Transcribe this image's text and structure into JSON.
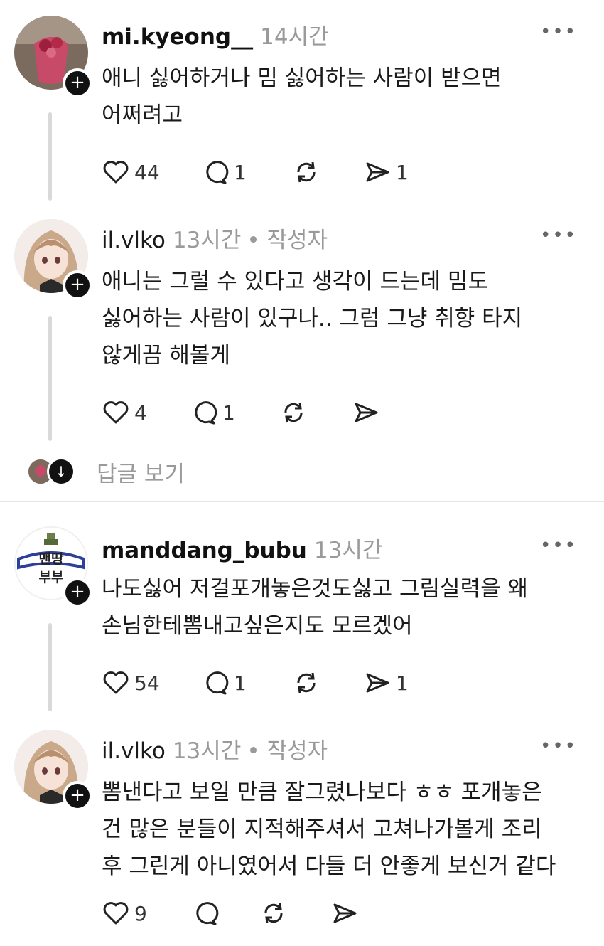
{
  "posts": [
    {
      "username": "mi.kyeong__",
      "time": "14시간",
      "author_tag": "",
      "lines": [
        "애니 싫어하거나 밈 싫어하는 사람이 받으면",
        "어쩌려고"
      ],
      "likes": "44",
      "replies": "1",
      "reposts": "",
      "shares": "1"
    },
    {
      "username": "il.vlko",
      "time": "13시간",
      "author_tag": "• 작성자",
      "lines": [
        "애니는 그럴 수 있다고 생각이 드는데 밈도",
        "싫어하는 사람이 있구나.. 그럼 그냥 취향 타지",
        "않게끔 해볼게"
      ],
      "likes": "4",
      "replies": "1",
      "reposts": "",
      "shares": ""
    },
    {
      "username": "manddang_bubu",
      "time": "13시간",
      "author_tag": "",
      "avatar_text": [
        "맨땅",
        "부부"
      ],
      "lines": [
        "나도싫어 저걸포개놓은것도싫고 그림실력을 왜",
        "손님한테뽐내고싶은지도 모르겠어"
      ],
      "likes": "54",
      "replies": "1",
      "reposts": "",
      "shares": "1"
    },
    {
      "username": "il.vlko",
      "time": "13시간",
      "author_tag": "• 작성자",
      "lines": [
        "뽐낸다고 보일 만큼 잘그렸나보다 ㅎㅎ 포개놓은",
        "건 많은 분들이 지적해주셔서 고쳐나가볼게 조리",
        "후 그린게 아니였어서 다들 더 안좋게 보신거 같다"
      ],
      "likes": "9",
      "replies": "",
      "reposts": "",
      "shares": ""
    }
  ],
  "see_replies": "답글 보기",
  "icons": {
    "like": "heart-icon",
    "reply": "comment-icon",
    "repost": "repost-icon",
    "share": "send-icon",
    "more": "more-dots-icon",
    "follow": "plus-icon",
    "expand": "arrow-down-icon"
  }
}
